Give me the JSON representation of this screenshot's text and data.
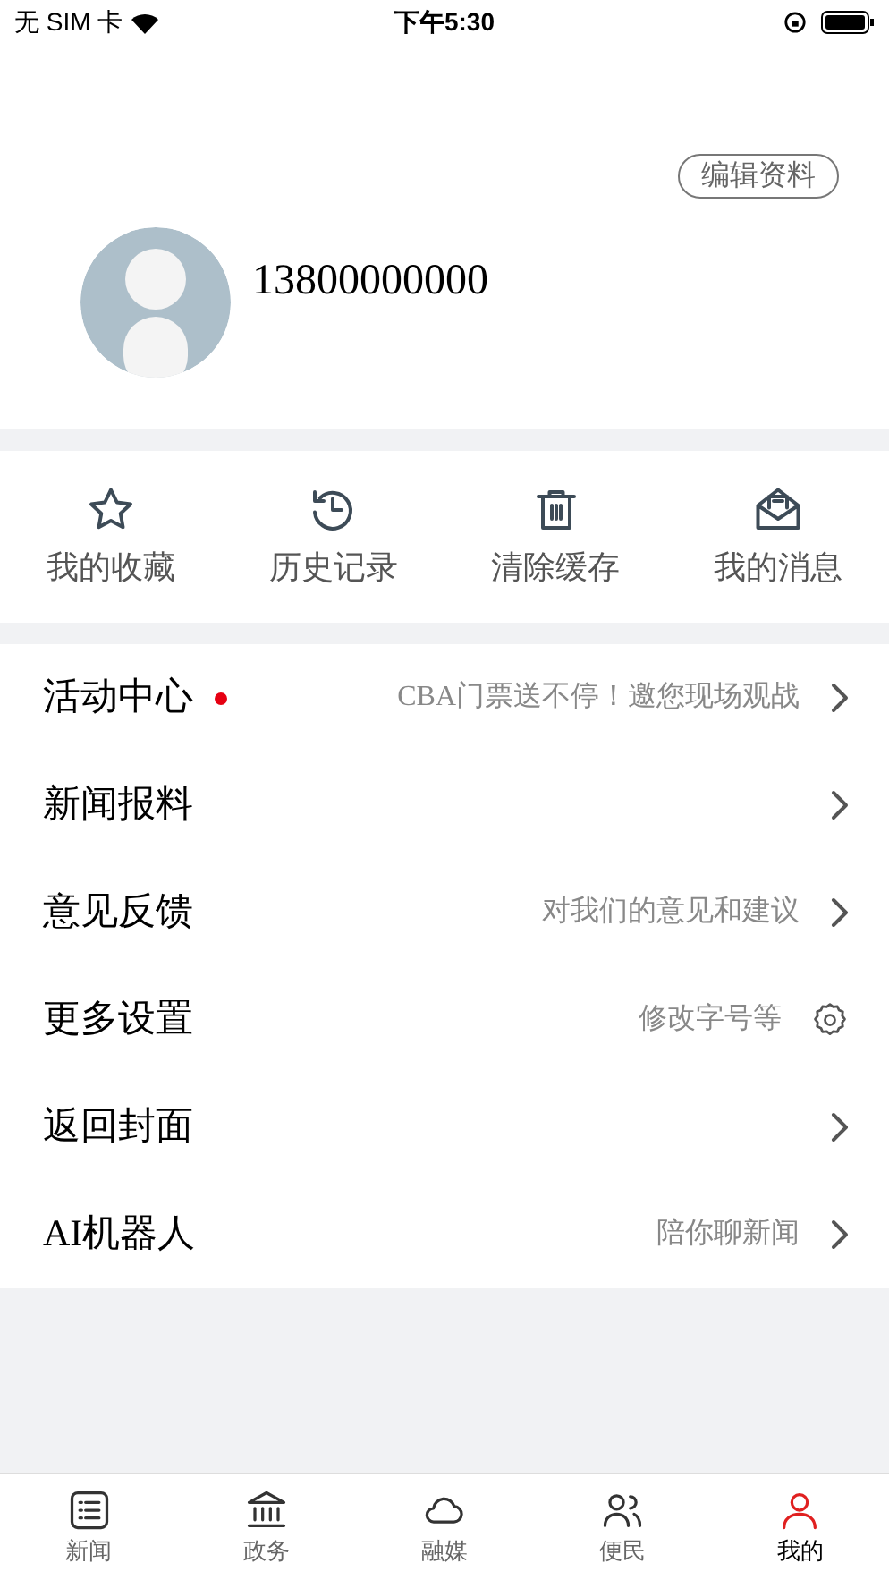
{
  "status_bar": {
    "carrier": "无 SIM 卡",
    "time": "下午5:30"
  },
  "profile": {
    "edit_button": "编辑资料",
    "phone": "13800000000"
  },
  "shortcuts": [
    {
      "kind": "star",
      "label": "我的收藏"
    },
    {
      "kind": "history",
      "label": "历史记录"
    },
    {
      "kind": "trash",
      "label": "清除缓存"
    },
    {
      "kind": "mail",
      "label": "我的消息"
    }
  ],
  "menu": [
    {
      "title": "活动中心",
      "badge": true,
      "hint": "CBA门票送不停！邀您现场观战",
      "kind": "chevron"
    },
    {
      "title": "新闻报料",
      "badge": false,
      "kind": "chevron"
    },
    {
      "title": "意见反馈",
      "badge": false,
      "hint": "对我们的意见和建议",
      "kind": "chevron"
    },
    {
      "title": "更多设置",
      "badge": false,
      "hint": "修改字号等",
      "kind": "gear"
    },
    {
      "title": "返回封面",
      "badge": false,
      "kind": "chevron"
    },
    {
      "title": "AI机器人",
      "badge": false,
      "hint": "陪你聊新闻",
      "kind": "chevron"
    }
  ],
  "tab_bar": [
    {
      "kind": "list",
      "label": "新闻",
      "selected": false
    },
    {
      "kind": "bank",
      "label": "政务",
      "selected": false
    },
    {
      "kind": "cloud",
      "label": "融媒",
      "selected": false
    },
    {
      "kind": "people",
      "label": "便民",
      "selected": false
    },
    {
      "kind": "user",
      "label": "我的",
      "selected": true
    }
  ]
}
